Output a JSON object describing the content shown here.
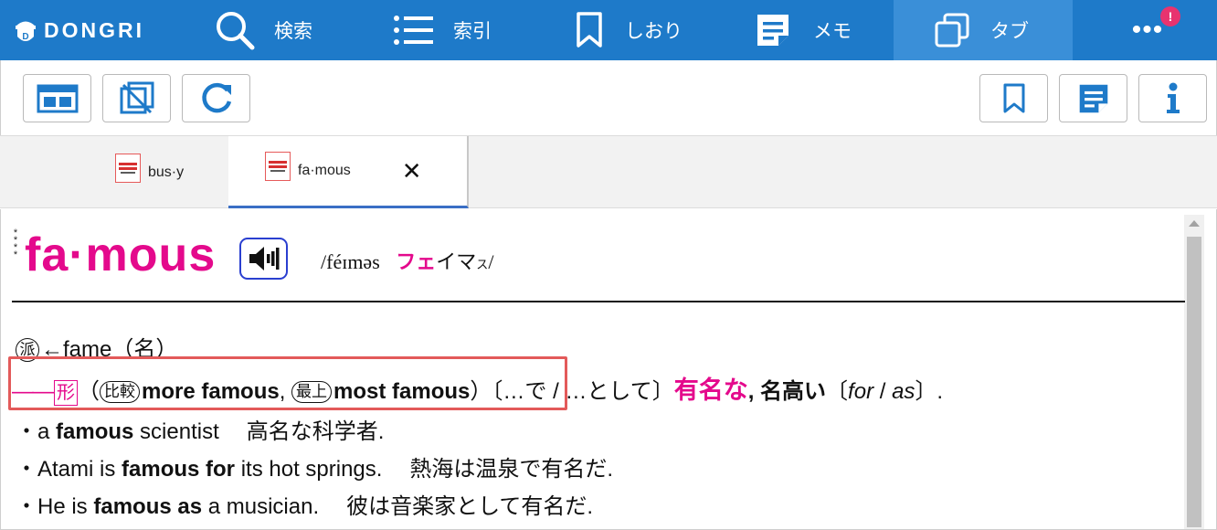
{
  "app": {
    "brand": "DONGRI",
    "accent_color": "#1e7ac9",
    "highlight_color": "#e4098c"
  },
  "nav": {
    "items": [
      {
        "label": "検索",
        "icon": "search-icon"
      },
      {
        "label": "索引",
        "icon": "list-icon"
      },
      {
        "label": "しおり",
        "icon": "bookmark-icon"
      },
      {
        "label": "メモ",
        "icon": "memo-icon"
      },
      {
        "label": "タブ",
        "icon": "tabs-icon"
      }
    ],
    "active": "タブ",
    "more_badge": "!"
  },
  "toolbar": {
    "left_buttons": [
      "layout-icon",
      "window-icon",
      "refresh-icon"
    ],
    "right_buttons": [
      "bookmark-icon",
      "memo-icon",
      "info-icon"
    ]
  },
  "tabs": [
    {
      "label": "bus·y",
      "active": false
    },
    {
      "label": "fa·mous",
      "active": true,
      "close": "✕"
    }
  ],
  "entry": {
    "frequency_stars": "****",
    "headword": "fa·mous",
    "pronunciation_ipa": "/féɪməs",
    "pronunciation_kana_stress": "フェ",
    "pronunciation_kana_rest": "イマ",
    "pronunciation_kana_small": "ス",
    "pronunciation_close": "/",
    "derivation": {
      "label": "派",
      "text": "←fame（名）"
    },
    "sense": {
      "dash": "——",
      "pos": "形",
      "open_paren": "（",
      "comparative_label": "比較",
      "comparative": "more famous",
      "comma1": ", ",
      "superlative_label": "最上",
      "superlative": "most famous",
      "close_paren": "）",
      "usage_note": "〔…で / …として〕",
      "meaning_main": "有名な",
      "meaning_sep": ", ",
      "meaning_alt": "名高い",
      "prep_open": "〔",
      "prep_for": "for",
      "prep_slash": " / ",
      "prep_as": "as",
      "prep_close": "〕."
    },
    "examples": [
      {
        "bullet": "・",
        "pre": "a ",
        "bold": "famous",
        "post": " scientist",
        "ja": "高名な科学者."
      },
      {
        "bullet": "・",
        "pre": "Atami is ",
        "bold": "famous for",
        "post": " its hot springs.",
        "ja": "熱海は温泉で有名だ."
      },
      {
        "bullet": "・",
        "pre": "He is ",
        "bold": "famous as",
        "post": " a musician.",
        "ja": "彼は音楽家として有名だ."
      }
    ]
  }
}
